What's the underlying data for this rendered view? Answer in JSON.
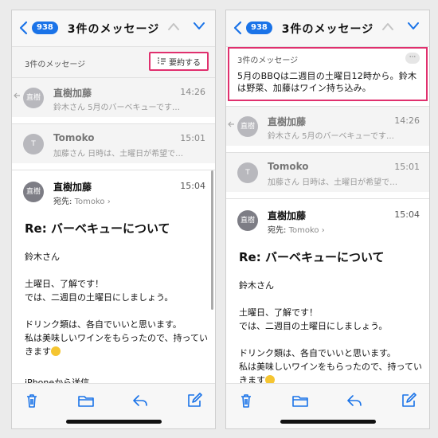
{
  "colors": {
    "accent": "#1a73e8",
    "highlight": "#e0306e",
    "avatar": "#b8b8bd"
  },
  "left": {
    "nav": {
      "badge": "938",
      "title": "3件のメッセージ"
    },
    "thread_count": "3件のメッセージ",
    "summarize_label": "要約する",
    "rows": [
      {
        "avatar": "直樹",
        "name": "直樹加藤",
        "time": "14:26",
        "preview": "鈴木さん 5月のバーベキューです…"
      },
      {
        "avatar": "T",
        "name": "Tomoko",
        "time": "15:01",
        "preview": "加藤さん 日時は、土曜日が希望で…"
      }
    ],
    "open": {
      "avatar": "直樹",
      "name": "直樹加藤",
      "to_label": "宛先:",
      "to_value": "Tomoko",
      "time": "15:04",
      "subject": "Re: バーベキューについて",
      "greeting": "鈴木さん",
      "line1": "土曜日、了解です！",
      "line2": "では、二週目の土曜日にしましょう。",
      "line3": "ドリンク類は、各自でいいと思います。",
      "line4": "私は美味しいワインをもらったので、持っていきます",
      "signature": "iPhoneから送信"
    }
  },
  "right": {
    "nav": {
      "badge": "938",
      "title": "3件のメッセージ"
    },
    "summary": {
      "label": "3件のメッセージ",
      "more": "···",
      "text": "5月のBBQは二週目の土曜日12時から。鈴木は野菜、加藤はワイン持ち込み。"
    },
    "rows": [
      {
        "avatar": "直樹",
        "name": "直樹加藤",
        "time": "14:26",
        "preview": "鈴木さん 5月のバーベキューです…"
      },
      {
        "avatar": "T",
        "name": "Tomoko",
        "time": "15:01",
        "preview": "加藤さん 日時は、土曜日が希望で…"
      }
    ],
    "open": {
      "avatar": "直樹",
      "name": "直樹加藤",
      "to_label": "宛先:",
      "to_value": "Tomoko",
      "time": "15:04",
      "subject": "Re: バーベキューについて",
      "greeting": "鈴木さん",
      "line1": "土曜日、了解です！",
      "line2": "では、二週目の土曜日にしましょう。",
      "line3": "ドリンク類は、各自でいいと思います。",
      "line4": "私は美味しいワインをもらったので、持っていきます"
    }
  },
  "toolbar_icons": [
    "trash-icon",
    "folder-icon",
    "reply-icon",
    "compose-icon"
  ]
}
